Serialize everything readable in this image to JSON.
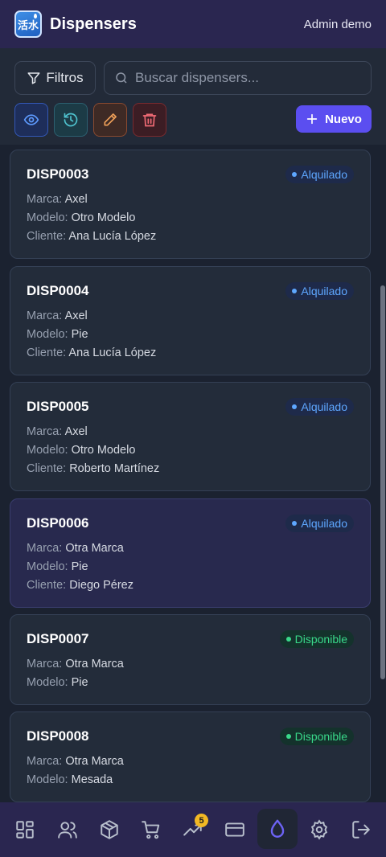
{
  "header": {
    "logo_text": "活水",
    "title": "Dispensers",
    "user": "Admin demo"
  },
  "toolbar": {
    "filters_label": "Filtros",
    "search_placeholder": "Buscar dispensers...",
    "search_value": "",
    "new_label": "Nuevo"
  },
  "labels": {
    "marca": "Marca:",
    "modelo": "Modelo:",
    "cliente": "Cliente:"
  },
  "dispensers": [
    {
      "code": "DISP0003",
      "status": "Alquilado",
      "marca": "Axel",
      "modelo": "Otro Modelo",
      "cliente": "Ana Lucía López"
    },
    {
      "code": "DISP0004",
      "status": "Alquilado",
      "marca": "Axel",
      "modelo": "Pie",
      "cliente": "Ana Lucía López"
    },
    {
      "code": "DISP0005",
      "status": "Alquilado",
      "marca": "Axel",
      "modelo": "Otro Modelo",
      "cliente": "Roberto Martínez"
    },
    {
      "code": "DISP0006",
      "status": "Alquilado",
      "marca": "Otra Marca",
      "modelo": "Pie",
      "cliente": "Diego Pérez"
    },
    {
      "code": "DISP0007",
      "status": "Disponible",
      "marca": "Otra Marca",
      "modelo": "Pie"
    },
    {
      "code": "DISP0008",
      "status": "Disponible",
      "marca": "Otra Marca",
      "modelo": "Mesada"
    }
  ],
  "nav": {
    "items": [
      "dashboard-icon",
      "users-icon",
      "package-icon",
      "cart-icon",
      "trending-icon",
      "card-icon",
      "droplet-icon",
      "settings-icon",
      "logout-icon"
    ],
    "trend_badge": "5",
    "active": "droplet-icon"
  },
  "colors": {
    "accent": "#5b4ef0",
    "alquilado": "#5ea7ff",
    "disponible": "#39d98a",
    "header_bg": "#2a2650"
  }
}
